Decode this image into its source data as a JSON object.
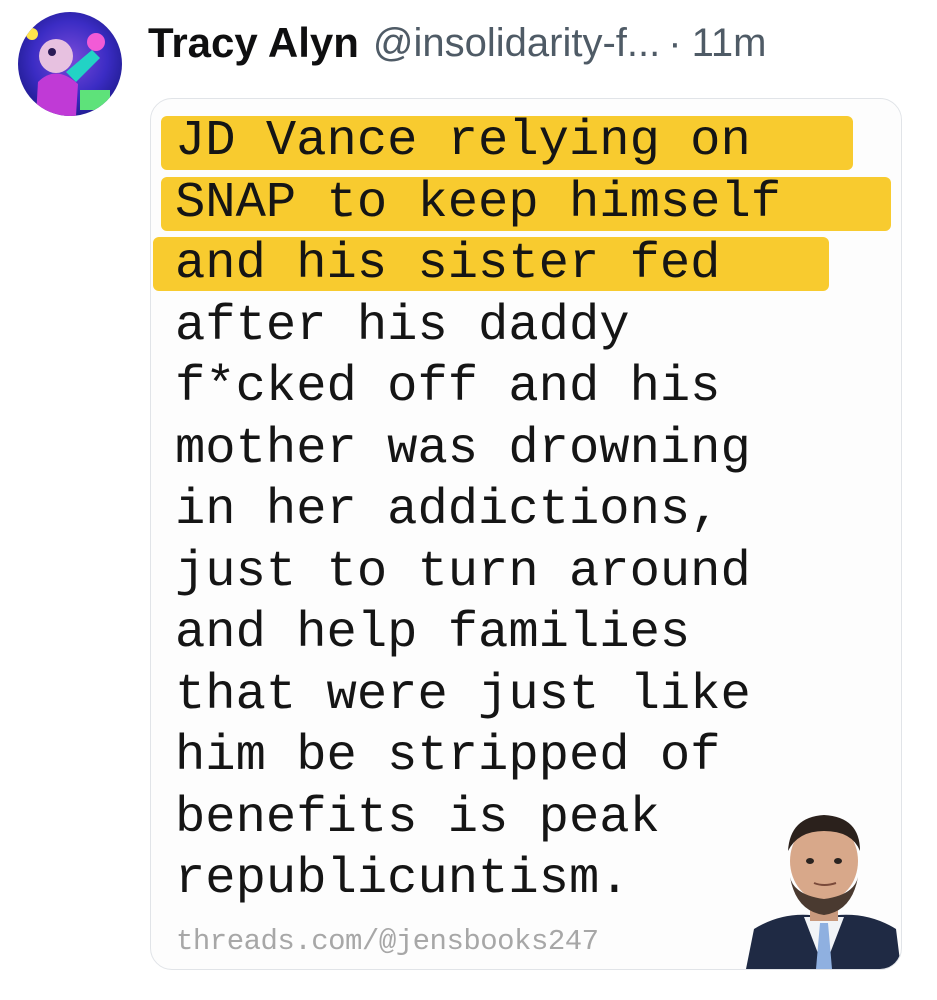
{
  "post": {
    "author_name": "Tracy Alyn",
    "handle": "@insolidarity-f...",
    "separator": "·",
    "time": "11m"
  },
  "image_text": {
    "lines": [
      "JD Vance relying on",
      "SNAP to keep himself",
      "and his sister fed",
      "after his daddy",
      "f*cked off and his",
      "mother was drowning",
      "in her addictions,",
      "just to turn around",
      "and help families",
      "that were just like",
      "him be stripped of",
      "benefits is peak",
      "republicuntism."
    ],
    "highlighted_line_count": 3,
    "source": "threads.com/@jensbooks247"
  },
  "colors": {
    "highlight": "#f8cb2f",
    "name_text": "#0f0f10",
    "meta_text": "#4f5b66",
    "watermark_text": "#a7a7a7"
  }
}
